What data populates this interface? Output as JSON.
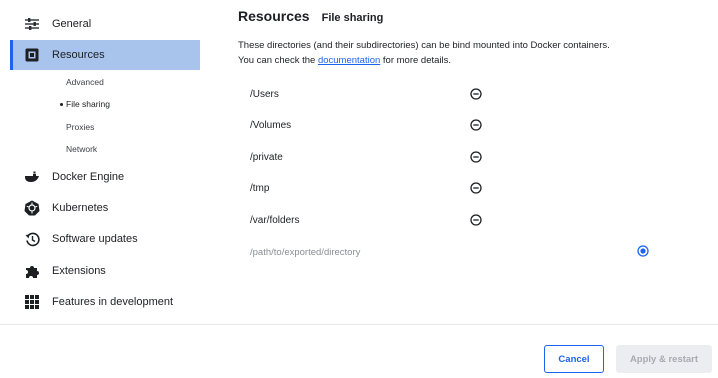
{
  "sidebar": {
    "items": [
      {
        "label": "General",
        "icon": "sliders-icon"
      },
      {
        "label": "Resources",
        "icon": "resources-icon",
        "active": true
      },
      {
        "label": "Docker Engine",
        "icon": "whale-icon"
      },
      {
        "label": "Kubernetes",
        "icon": "kubernetes-icon"
      },
      {
        "label": "Software updates",
        "icon": "history-icon"
      },
      {
        "label": "Extensions",
        "icon": "puzzle-icon"
      },
      {
        "label": "Features in development",
        "icon": "grid-icon"
      }
    ],
    "resources_sub": [
      {
        "label": "Advanced"
      },
      {
        "label": "File sharing",
        "active": true
      },
      {
        "label": "Proxies"
      },
      {
        "label": "Network"
      }
    ]
  },
  "main": {
    "title": "Resources",
    "subtitle": "File sharing",
    "desc_line1": "These directories (and their subdirectories) can be bind mounted into Docker containers.",
    "desc_line2_prefix": "You can check the ",
    "desc_link": "documentation",
    "desc_line2_suffix": " for more details.",
    "directories": [
      "/Users",
      "/Volumes",
      "/private",
      "/tmp",
      "/var/folders"
    ],
    "new_path_placeholder": "/path/to/exported/directory"
  },
  "footer": {
    "cancel_label": "Cancel",
    "apply_label": "Apply & restart"
  },
  "colors": {
    "accent": "#1d63ed",
    "active_bg": "#a9c4ec",
    "disabled_bg": "#ebedf0"
  }
}
